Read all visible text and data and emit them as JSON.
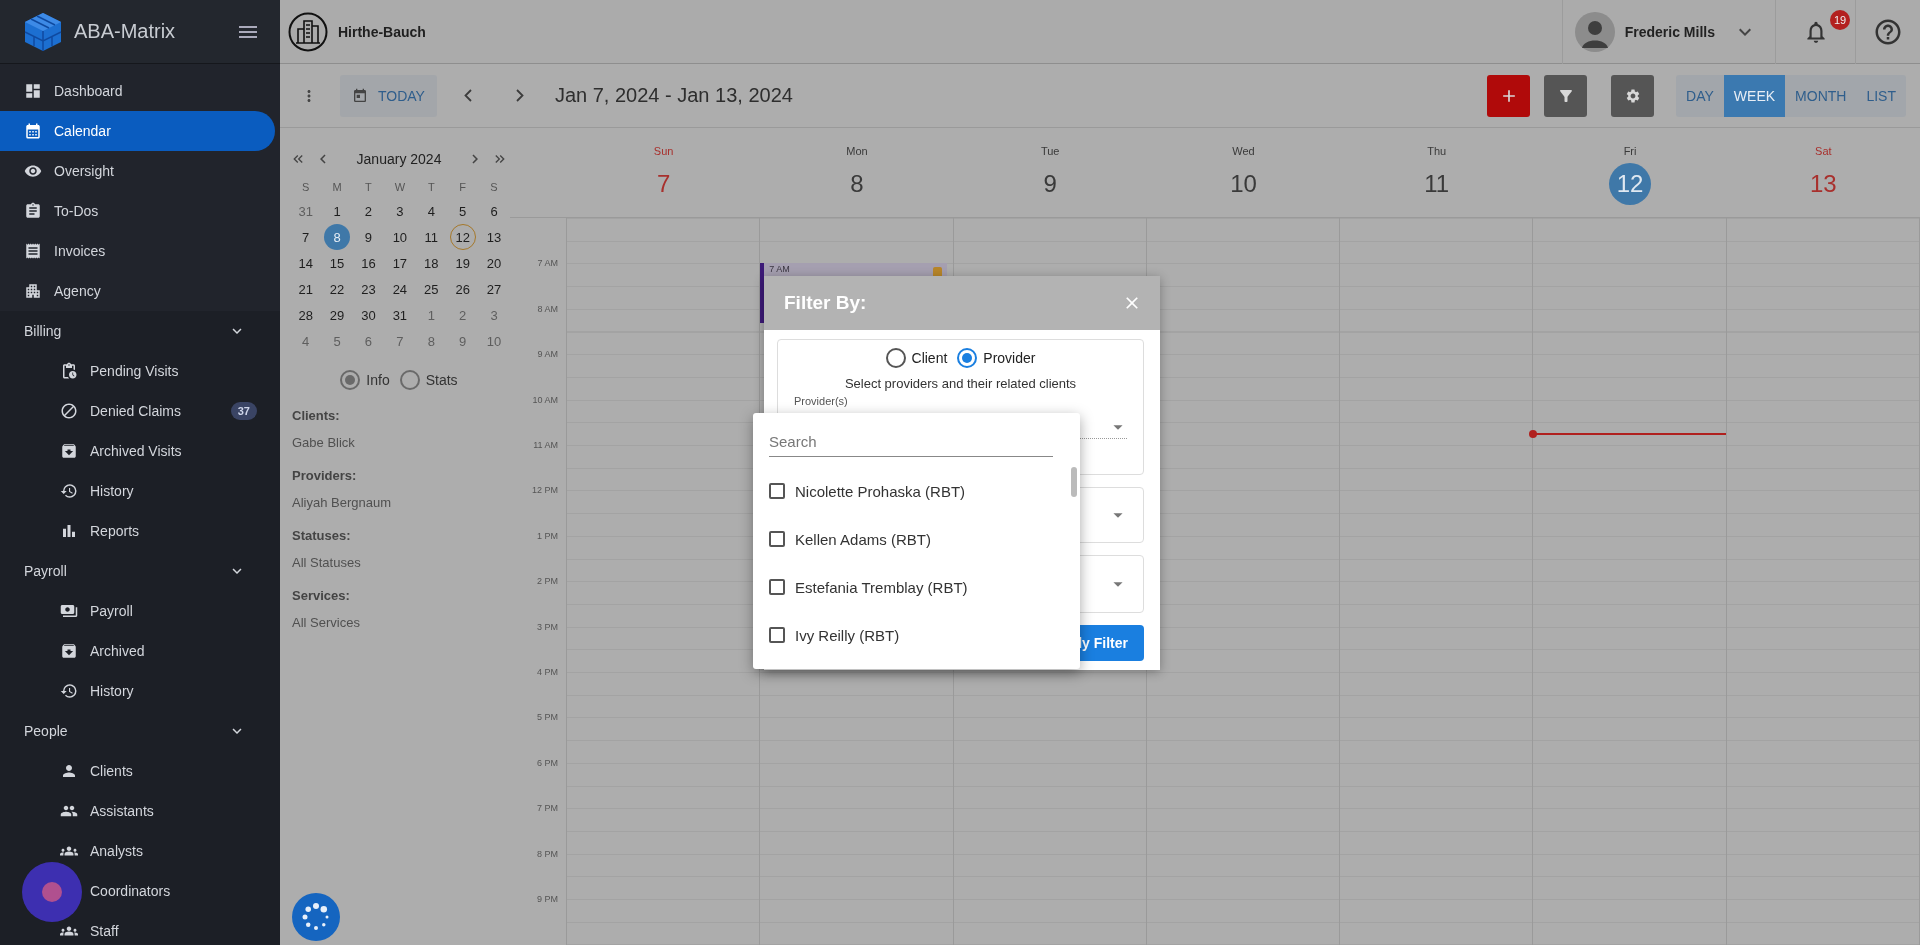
{
  "sidebar": {
    "brand": "ABA-Matrix",
    "items": [
      {
        "label": "Dashboard",
        "selected": false
      },
      {
        "label": "Calendar",
        "selected": true
      },
      {
        "label": "Oversight",
        "selected": false
      },
      {
        "label": "To-Dos",
        "selected": false
      },
      {
        "label": "Invoices",
        "selected": false
      },
      {
        "label": "Agency",
        "selected": false
      }
    ],
    "sections": [
      {
        "title": "Billing",
        "expanded": true,
        "items": [
          {
            "label": "Pending Visits",
            "selected": false
          },
          {
            "label": "Denied Claims",
            "selected": false,
            "badge": "37"
          },
          {
            "label": "Archived Visits",
            "selected": false
          },
          {
            "label": "History",
            "selected": false
          },
          {
            "label": "Reports",
            "selected": false
          }
        ]
      },
      {
        "title": "Payroll",
        "expanded": true,
        "items": [
          {
            "label": "Payroll",
            "selected": false
          },
          {
            "label": "Archived",
            "selected": false
          },
          {
            "label": "History",
            "selected": false
          }
        ]
      },
      {
        "title": "People",
        "expanded": true,
        "items": [
          {
            "label": "Clients",
            "selected": false
          },
          {
            "label": "Assistants",
            "selected": false
          },
          {
            "label": "Analysts",
            "selected": false
          },
          {
            "label": "Coordinators",
            "selected": false
          },
          {
            "label": "Staff",
            "selected": false
          }
        ]
      }
    ]
  },
  "topbar": {
    "organization": "Hirthe-Bauch",
    "user": "Frederic Mills",
    "notifications": "19"
  },
  "toolbar": {
    "today": "TODAY",
    "range": "Jan 7, 2024 - Jan 13, 2024",
    "views": [
      {
        "label": "DAY",
        "selected": false
      },
      {
        "label": "WEEK",
        "selected": true
      },
      {
        "label": "MONTH",
        "selected": false
      },
      {
        "label": "LIST",
        "selected": false
      }
    ]
  },
  "mini_calendar": {
    "title": "January 2024",
    "weekdays": [
      "S",
      "M",
      "T",
      "W",
      "T",
      "F",
      "S"
    ],
    "weeks": [
      [
        {
          "d": "31",
          "outside": true,
          "selected": false,
          "today": false
        },
        {
          "d": "1",
          "outside": false,
          "selected": false,
          "today": false
        },
        {
          "d": "2",
          "outside": false,
          "selected": false,
          "today": false
        },
        {
          "d": "3",
          "outside": false,
          "selected": false,
          "today": false
        },
        {
          "d": "4",
          "outside": false,
          "selected": false,
          "today": false
        },
        {
          "d": "5",
          "outside": false,
          "selected": false,
          "today": false
        },
        {
          "d": "6",
          "outside": false,
          "selected": false,
          "today": false
        }
      ],
      [
        {
          "d": "7",
          "outside": false,
          "selected": false,
          "today": false
        },
        {
          "d": "8",
          "outside": false,
          "selected": true,
          "today": false
        },
        {
          "d": "9",
          "outside": false,
          "selected": false,
          "today": false
        },
        {
          "d": "10",
          "outside": false,
          "selected": false,
          "today": false
        },
        {
          "d": "11",
          "outside": false,
          "selected": false,
          "today": false
        },
        {
          "d": "12",
          "outside": false,
          "selected": false,
          "today": true
        },
        {
          "d": "13",
          "outside": false,
          "selected": false,
          "today": false
        }
      ],
      [
        {
          "d": "14",
          "outside": false,
          "selected": false,
          "today": false
        },
        {
          "d": "15",
          "outside": false,
          "selected": false,
          "today": false
        },
        {
          "d": "16",
          "outside": false,
          "selected": false,
          "today": false
        },
        {
          "d": "17",
          "outside": false,
          "selected": false,
          "today": false
        },
        {
          "d": "18",
          "outside": false,
          "selected": false,
          "today": false
        },
        {
          "d": "19",
          "outside": false,
          "selected": false,
          "today": false
        },
        {
          "d": "20",
          "outside": false,
          "selected": false,
          "today": false
        }
      ],
      [
        {
          "d": "21",
          "outside": false,
          "selected": false,
          "today": false
        },
        {
          "d": "22",
          "outside": false,
          "selected": false,
          "today": false
        },
        {
          "d": "23",
          "outside": false,
          "selected": false,
          "today": false
        },
        {
          "d": "24",
          "outside": false,
          "selected": false,
          "today": false
        },
        {
          "d": "25",
          "outside": false,
          "selected": false,
          "today": false
        },
        {
          "d": "26",
          "outside": false,
          "selected": false,
          "today": false
        },
        {
          "d": "27",
          "outside": false,
          "selected": false,
          "today": false
        }
      ],
      [
        {
          "d": "28",
          "outside": false,
          "selected": false,
          "today": false
        },
        {
          "d": "29",
          "outside": false,
          "selected": false,
          "today": false
        },
        {
          "d": "30",
          "outside": false,
          "selected": false,
          "today": false
        },
        {
          "d": "31",
          "outside": false,
          "selected": false,
          "today": false
        },
        {
          "d": "1",
          "outside": true,
          "selected": false,
          "today": false
        },
        {
          "d": "2",
          "outside": true,
          "selected": false,
          "today": false
        },
        {
          "d": "3",
          "outside": true,
          "selected": false,
          "today": false
        }
      ],
      [
        {
          "d": "4",
          "outside": true,
          "selected": false,
          "today": false
        },
        {
          "d": "5",
          "outside": true,
          "selected": false,
          "today": false
        },
        {
          "d": "6",
          "outside": true,
          "selected": false,
          "today": false
        },
        {
          "d": "7",
          "outside": true,
          "selected": false,
          "today": false
        },
        {
          "d": "8",
          "outside": true,
          "selected": false,
          "today": false
        },
        {
          "d": "9",
          "outside": true,
          "selected": false,
          "today": false
        },
        {
          "d": "10",
          "outside": true,
          "selected": false,
          "today": false
        }
      ]
    ]
  },
  "panel_modes": [
    {
      "label": "Info",
      "selected": true
    },
    {
      "label": "Stats",
      "selected": false
    }
  ],
  "summary": [
    {
      "heading": "Clients:",
      "value": "Gabe Blick"
    },
    {
      "heading": "Providers:",
      "value": "Aliyah Bergnaum"
    },
    {
      "heading": "Statuses:",
      "value": "All Statuses"
    },
    {
      "heading": "Services:",
      "value": "All Services"
    }
  ],
  "week": {
    "days": [
      {
        "name": "Sun",
        "date": "7",
        "weekend": true,
        "today": false
      },
      {
        "name": "Mon",
        "date": "8",
        "weekend": false,
        "today": false,
        "events": [
          {
            "time": "7 AM",
            "color": "#3d1a78"
          }
        ]
      },
      {
        "name": "Tue",
        "date": "9",
        "weekend": false,
        "today": false
      },
      {
        "name": "Wed",
        "date": "10",
        "weekend": false,
        "today": false
      },
      {
        "name": "Thu",
        "date": "11",
        "weekend": false,
        "today": false
      },
      {
        "name": "Fri",
        "date": "12",
        "weekend": false,
        "today": true
      },
      {
        "name": "Sat",
        "date": "13",
        "weekend": true,
        "today": false
      }
    ],
    "hours": [
      "7 AM",
      "8 AM",
      "9 AM",
      "10 AM",
      "11 AM",
      "12 PM",
      "1 PM",
      "2 PM",
      "3 PM",
      "4 PM",
      "5 PM",
      "6 PM",
      "7 PM",
      "8 PM",
      "9 PM"
    ]
  },
  "filter_modal": {
    "title": "Filter By:",
    "modes": [
      {
        "label": "Client",
        "selected": false
      },
      {
        "label": "Provider",
        "selected": true
      }
    ],
    "hint": "Select providers and their related clients",
    "field_label": "Provider(s)",
    "apply": "ly Filter",
    "dropdown": {
      "placeholder": "Search",
      "options": [
        {
          "label": "Nicolette Prohaska (RBT)",
          "checked": false
        },
        {
          "label": "Kellen Adams (RBT)",
          "checked": false
        },
        {
          "label": "Estefania Tremblay (RBT)",
          "checked": false
        },
        {
          "label": "Ivy Reilly (RBT)",
          "checked": false
        }
      ]
    }
  }
}
